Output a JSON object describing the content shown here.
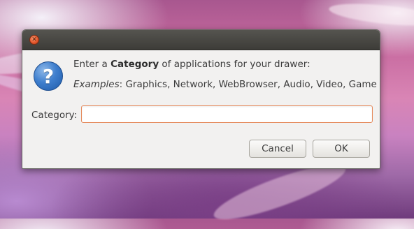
{
  "dialog": {
    "close_glyph": "✕",
    "icon_glyph": "?",
    "prompt": {
      "before": "Enter a ",
      "bold": "Category",
      "after": " of applications for your drawer:"
    },
    "examples": {
      "label": "Examples",
      "text": ": Graphics, Network, WebBrowser, Audio, Video, Game"
    },
    "category_label": "Category:",
    "category_value": "",
    "cancel_label": "Cancel",
    "ok_label": "OK"
  },
  "colors": {
    "titlebar": "#3d3c38",
    "dialog_bg": "#f2f1f0",
    "close_button": "#e5582e",
    "input_focus_border": "#e58a5c",
    "question_icon": "#3f7fce"
  }
}
